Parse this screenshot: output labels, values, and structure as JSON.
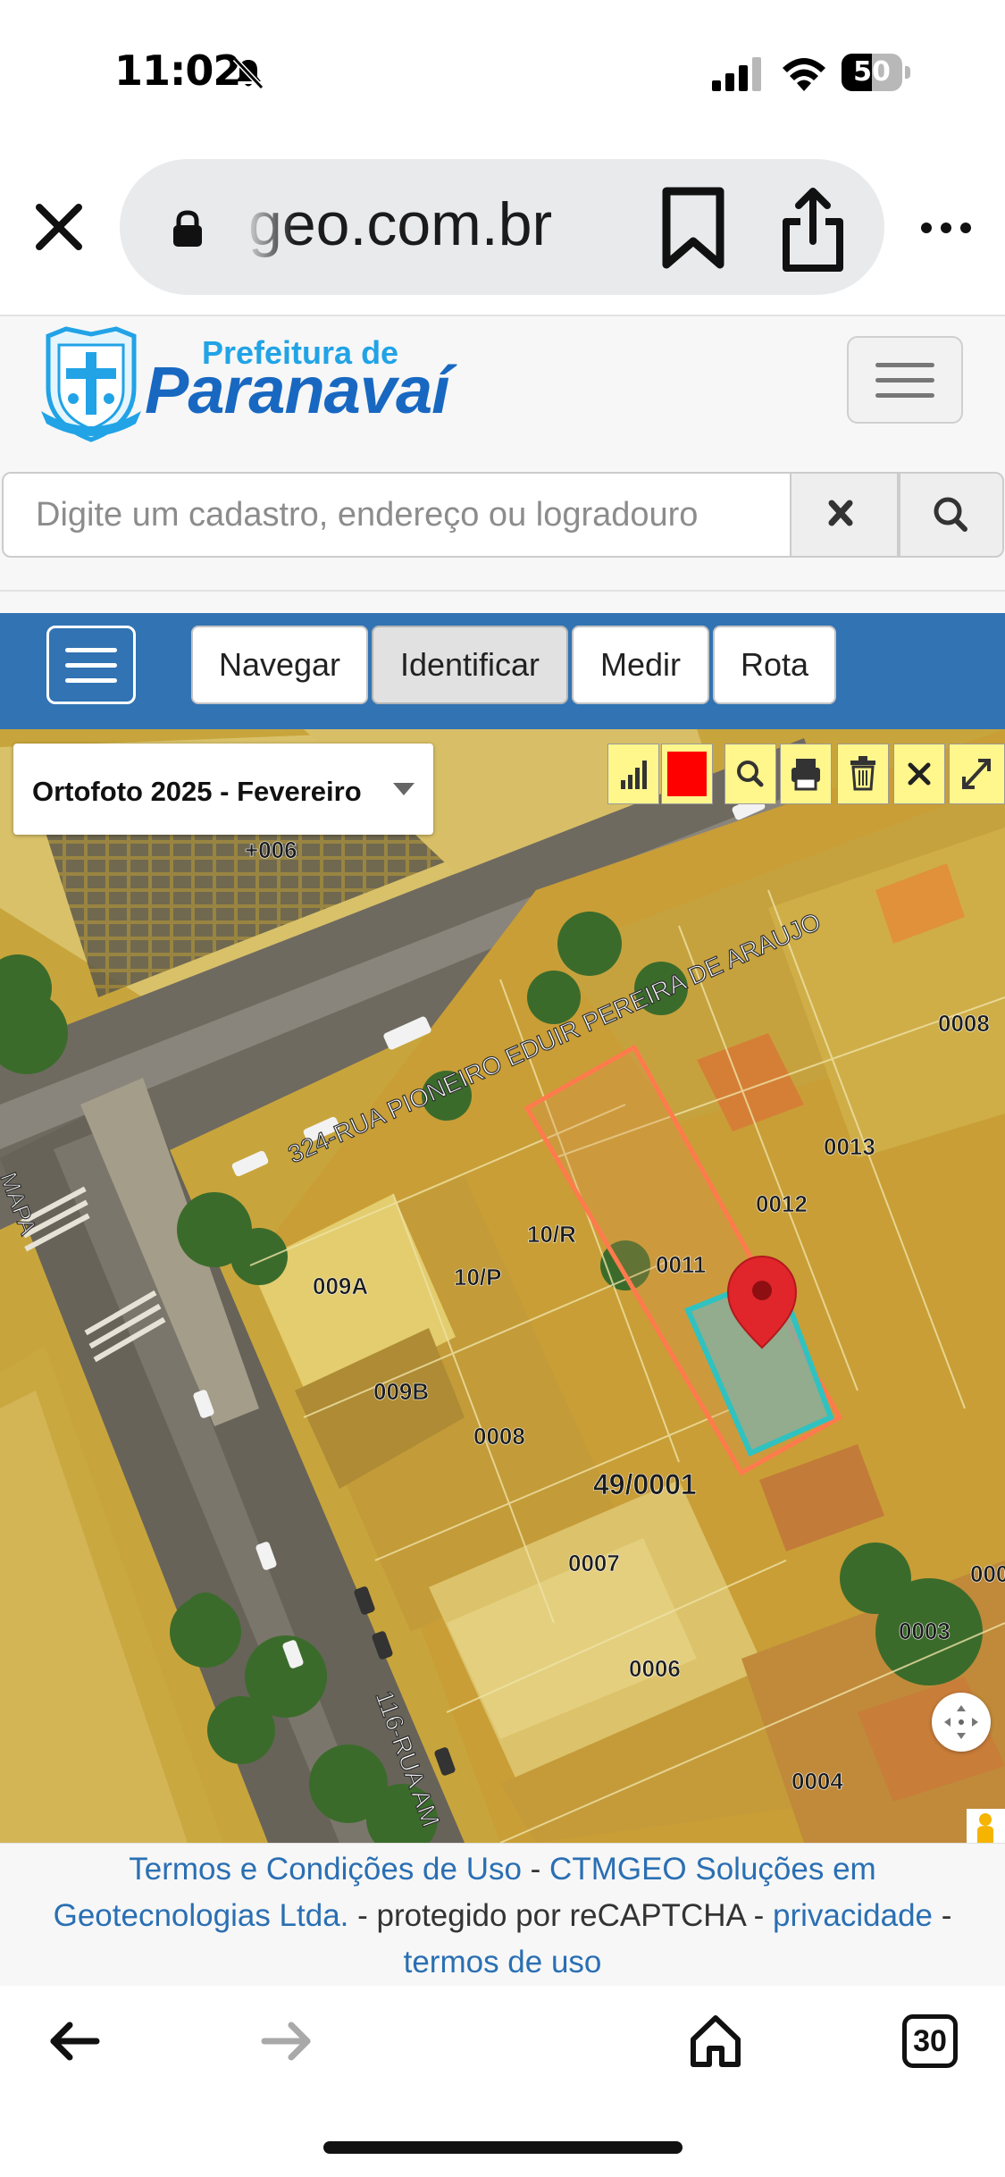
{
  "status_bar": {
    "time": "11:02",
    "battery": "50",
    "battery_level": 0.5
  },
  "browser": {
    "url": "geo.com.br",
    "tabs_count": "30"
  },
  "site": {
    "logo_line1": "Prefeitura de",
    "logo_line2": "Paranavaí",
    "search_placeholder": "Digite um cadastro, endereço ou logradouro"
  },
  "toolbar": {
    "tabs": [
      {
        "label": "Navegar",
        "active": false
      },
      {
        "label": "Identificar",
        "active": true
      },
      {
        "label": "Medir",
        "active": false
      },
      {
        "label": "Rota",
        "active": false
      }
    ]
  },
  "map": {
    "layer": "Ortofoto 2025 - Fevereiro",
    "highlight_color": "#ff0000",
    "tools": [
      "signal-icon",
      "color-swatch",
      "search-icon",
      "print-icon",
      "trash-icon",
      "close-icon",
      "expand-icon"
    ],
    "streets": {
      "main": "324-RUA PIONEIRO EDUIR PEREIRA DE ARAUJO",
      "side": "116-RUA AM",
      "left": "MAPA"
    },
    "lot_labels": [
      "+006",
      "0008",
      "0013",
      "0012",
      "10/R",
      "0011",
      "009A",
      "10/P",
      "009B",
      "0008",
      "49/0001",
      "0007",
      "0006",
      "000",
      "0003",
      "0004"
    ]
  },
  "footer": {
    "terms": "Termos e Condições de Uso",
    "sep1": " - ",
    "company": "CTMGEO Soluções em Geotecnologias Ltda.",
    "recaptcha": " - protegido por reCAPTCHA - ",
    "privacy": "privacidade",
    "sep2": " - ",
    "terms_of_use": "termos de uso"
  }
}
